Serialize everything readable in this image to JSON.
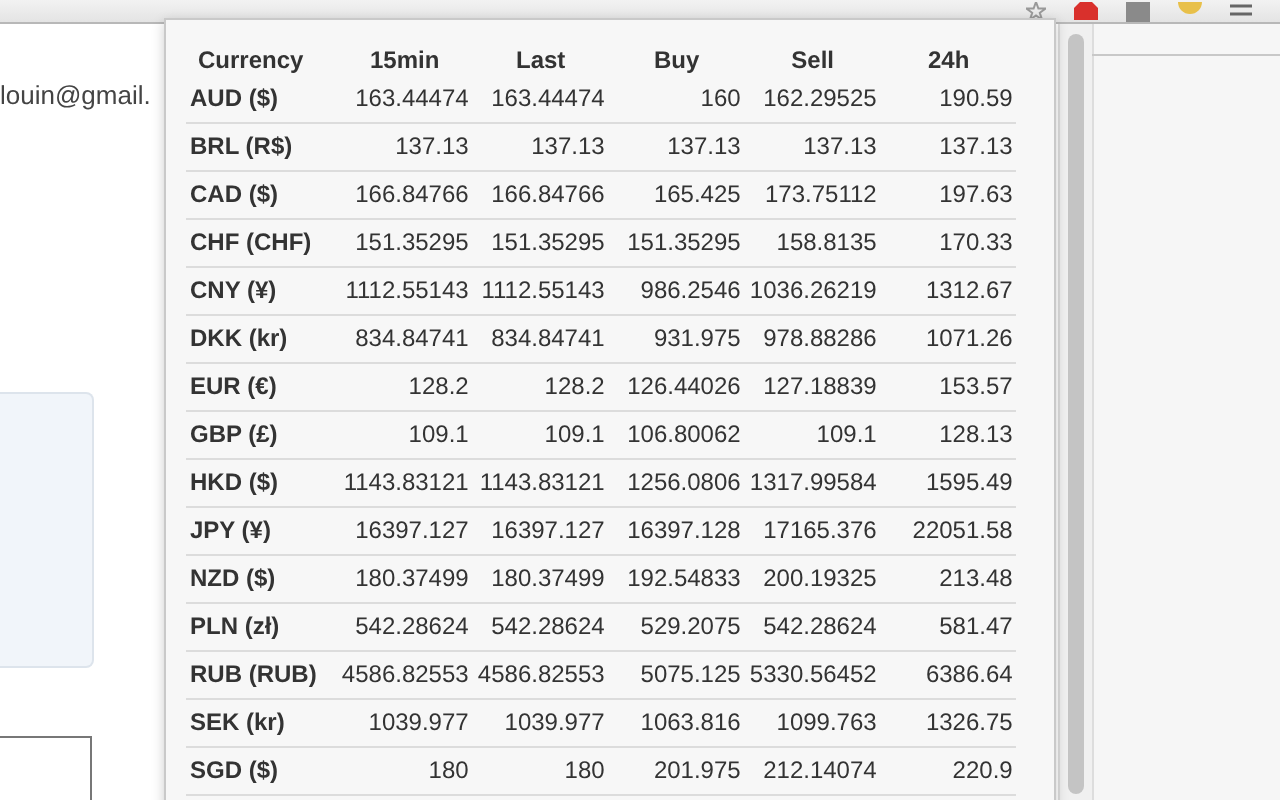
{
  "page": {
    "email_text": "louin@gmail."
  },
  "popup": {
    "columns": [
      "Currency",
      "15min",
      "Last",
      "Buy",
      "Sell",
      "24h"
    ],
    "rows": [
      [
        "AUD ($)",
        "163.44474",
        "163.44474",
        "160",
        "162.29525",
        "190.59"
      ],
      [
        "BRL (R$)",
        "137.13",
        "137.13",
        "137.13",
        "137.13",
        "137.13"
      ],
      [
        "CAD ($)",
        "166.84766",
        "166.84766",
        "165.425",
        "173.75112",
        "197.63"
      ],
      [
        "CHF (CHF)",
        "151.35295",
        "151.35295",
        "151.35295",
        "158.8135",
        "170.33"
      ],
      [
        "CNY (¥)",
        "1112.55143",
        "1112.55143",
        "986.2546",
        "1036.26219",
        "1312.67"
      ],
      [
        "DKK (kr)",
        "834.84741",
        "834.84741",
        "931.975",
        "978.88286",
        "1071.26"
      ],
      [
        "EUR (€)",
        "128.2",
        "128.2",
        "126.44026",
        "127.18839",
        "153.57"
      ],
      [
        "GBP (£)",
        "109.1",
        "109.1",
        "106.80062",
        "109.1",
        "128.13"
      ],
      [
        "HKD ($)",
        "1143.83121",
        "1143.83121",
        "1256.0806",
        "1317.99584",
        "1595.49"
      ],
      [
        "JPY (¥)",
        "16397.127",
        "16397.127",
        "16397.128",
        "17165.376",
        "22051.58"
      ],
      [
        "NZD ($)",
        "180.37499",
        "180.37499",
        "192.54833",
        "200.19325",
        "213.48"
      ],
      [
        "PLN (zł)",
        "542.28624",
        "542.28624",
        "529.2075",
        "542.28624",
        "581.47"
      ],
      [
        "RUB (RUB)",
        "4586.82553",
        "4586.82553",
        "5075.125",
        "5330.56452",
        "6386.64"
      ],
      [
        "SEK (kr)",
        "1039.977",
        "1039.977",
        "1063.816",
        "1099.763",
        "1326.75"
      ],
      [
        "SGD ($)",
        "180",
        "180",
        "201.975",
        "212.14074",
        "220.9"
      ]
    ]
  }
}
